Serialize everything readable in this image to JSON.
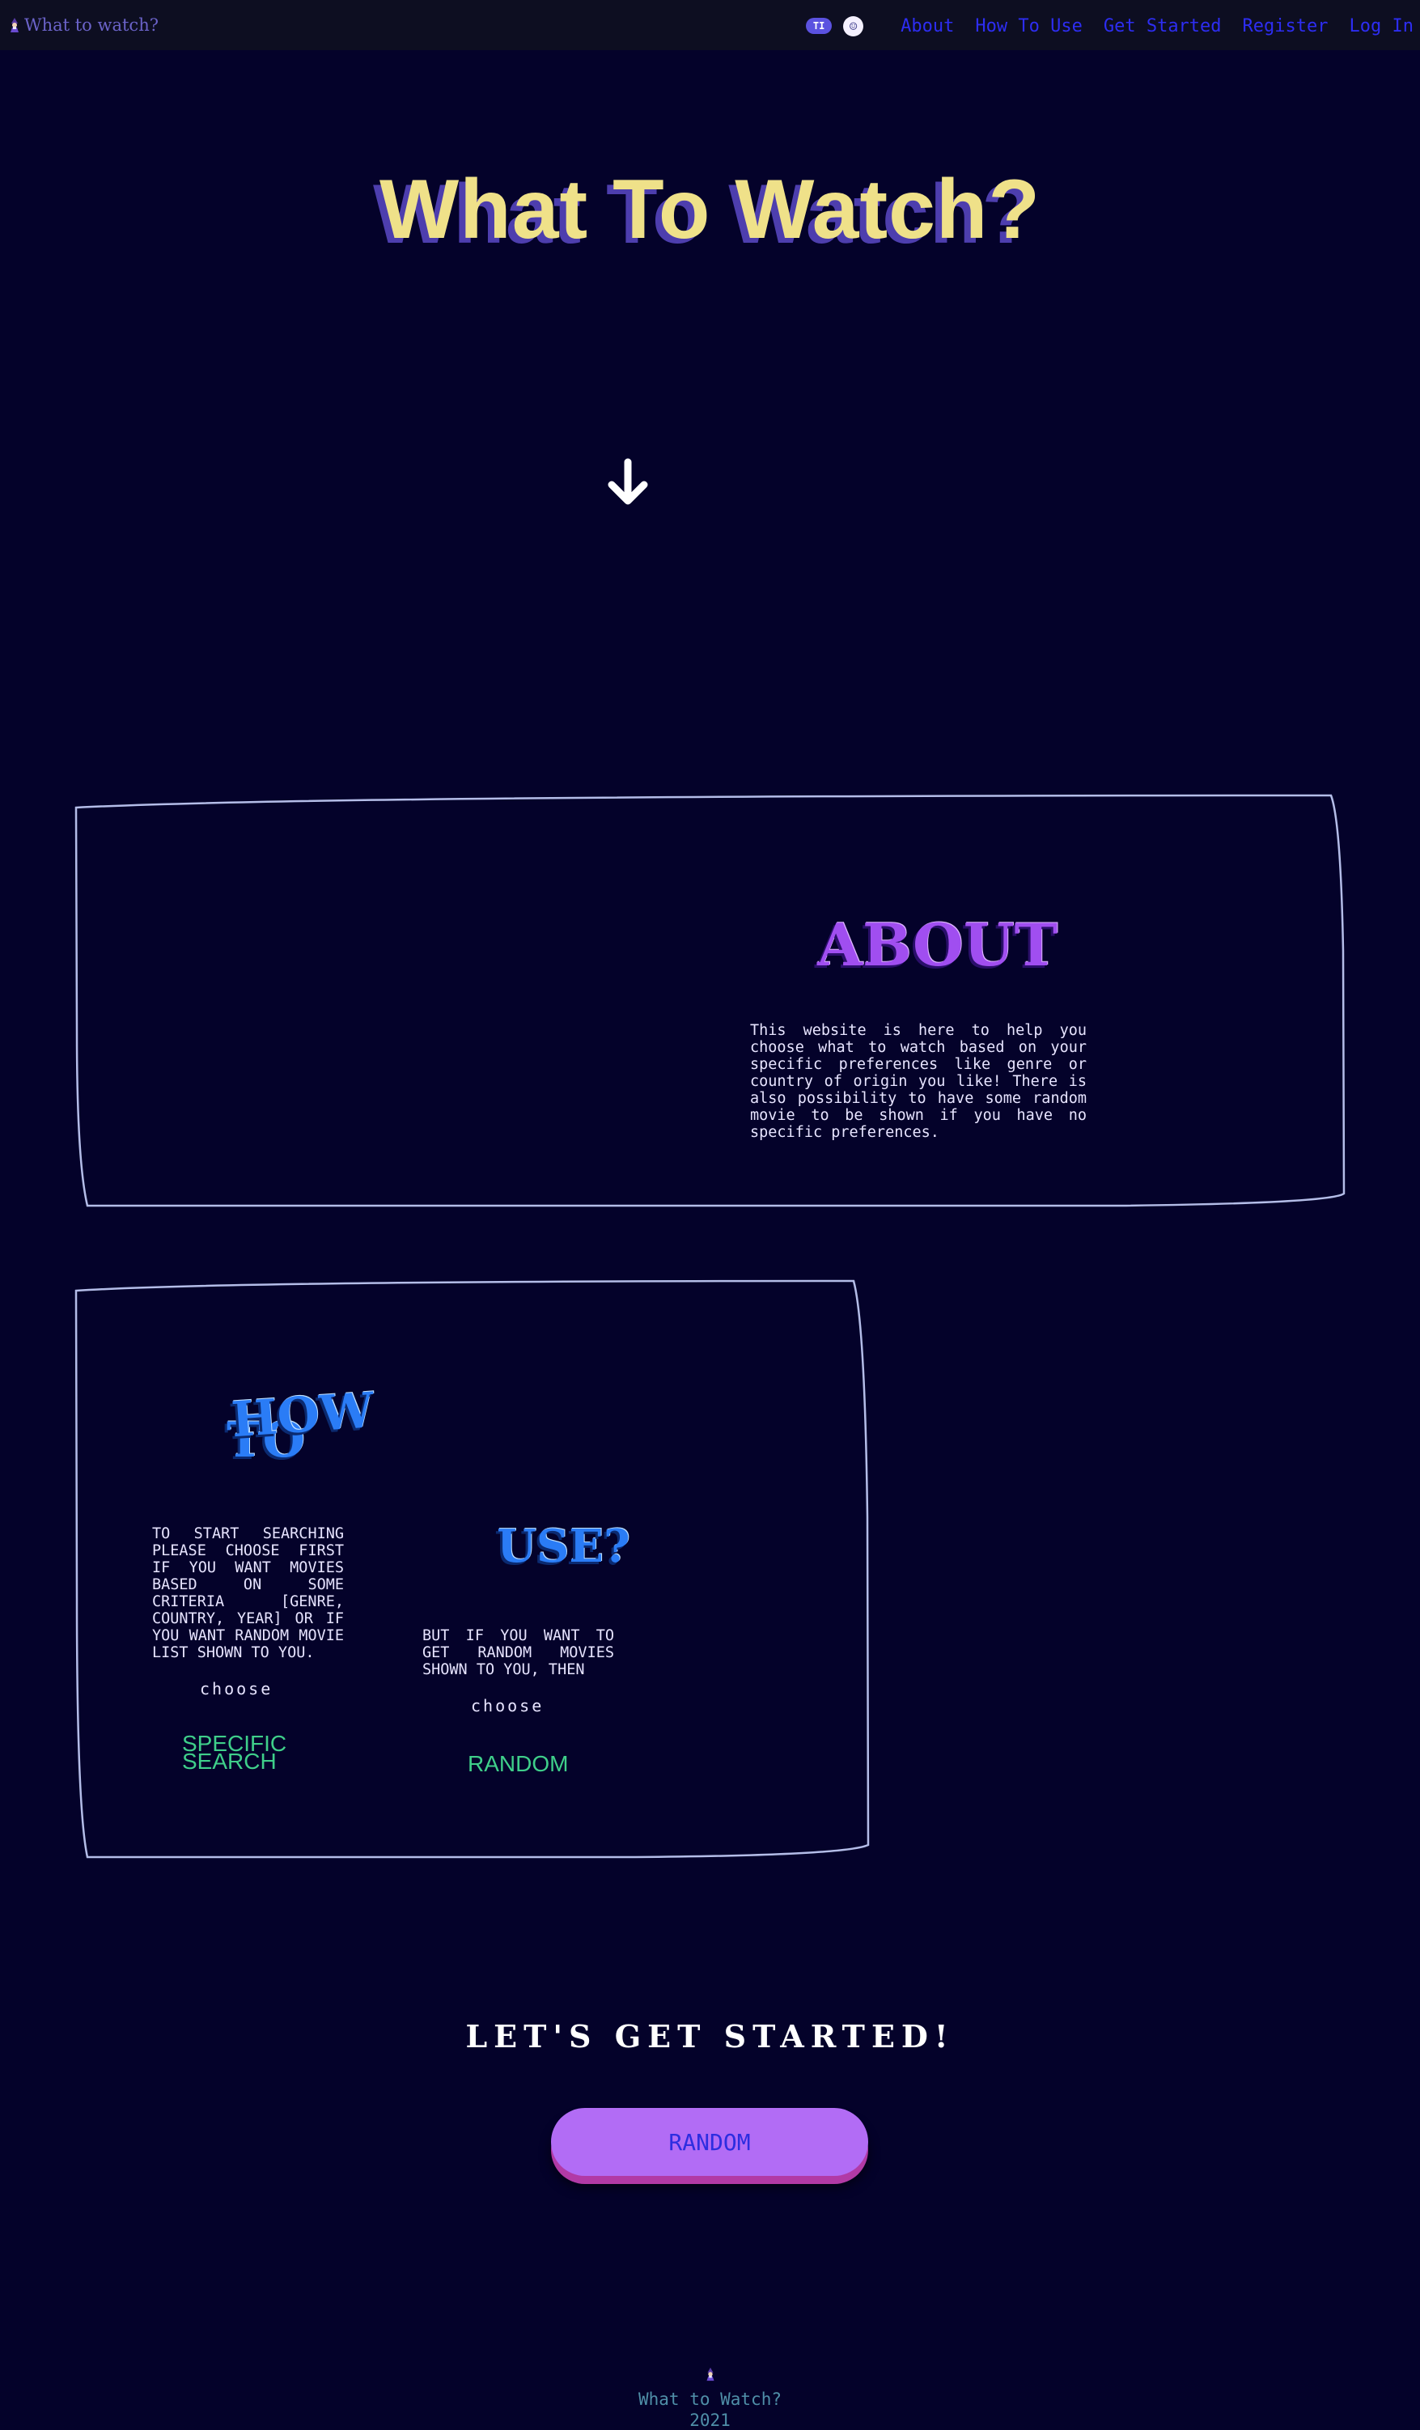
{
  "nav": {
    "brand": "What to watch?",
    "toggle_left": "TI",
    "toggle_right": "☺",
    "links": [
      "About",
      "How To Use",
      "Get Started",
      "Register",
      "Log In"
    ]
  },
  "hero": {
    "title": "What To Watch?"
  },
  "about": {
    "title": "ABOUT",
    "text": "This website is here to help you choose what to watch based on your specific preferences like genre or country of origin you like! There is also possibility to have some random movie to be shown if you have no specific preferences."
  },
  "how_to_use": {
    "title_line1": "HOW",
    "title_line2": "TO",
    "title_use": "USE?",
    "text1": "To start searching please choose first if you want movies based on some criteria [genre, country, year] or if you want random movie list shown to you.",
    "choose1": "choose",
    "specific_line1": "SPECIFIC",
    "specific_line2": "SEARCH",
    "text2": "But if you want to get random movies shown to you, then",
    "choose2": "choose",
    "random_link": "RANDOM"
  },
  "get_started": {
    "title": "LET'S GET STARTED!",
    "button": "RANDOM"
  },
  "footer": {
    "name": "What to Watch?",
    "year": "2021"
  },
  "colors": {
    "background": "#04022a",
    "navbar": "#0d0e21",
    "nav_link": "#2d2df2",
    "hero_text": "#efe189",
    "hero_shadow": "#4d3eae",
    "about_title": "#a04ef0",
    "how_title": "#2a7cf6",
    "green_link": "#3fcf8a",
    "button": "#b26cf5",
    "frame": "#b4bde8"
  },
  "icons": {
    "brand": "wizard-icon",
    "scroll": "arrow-down-icon"
  }
}
